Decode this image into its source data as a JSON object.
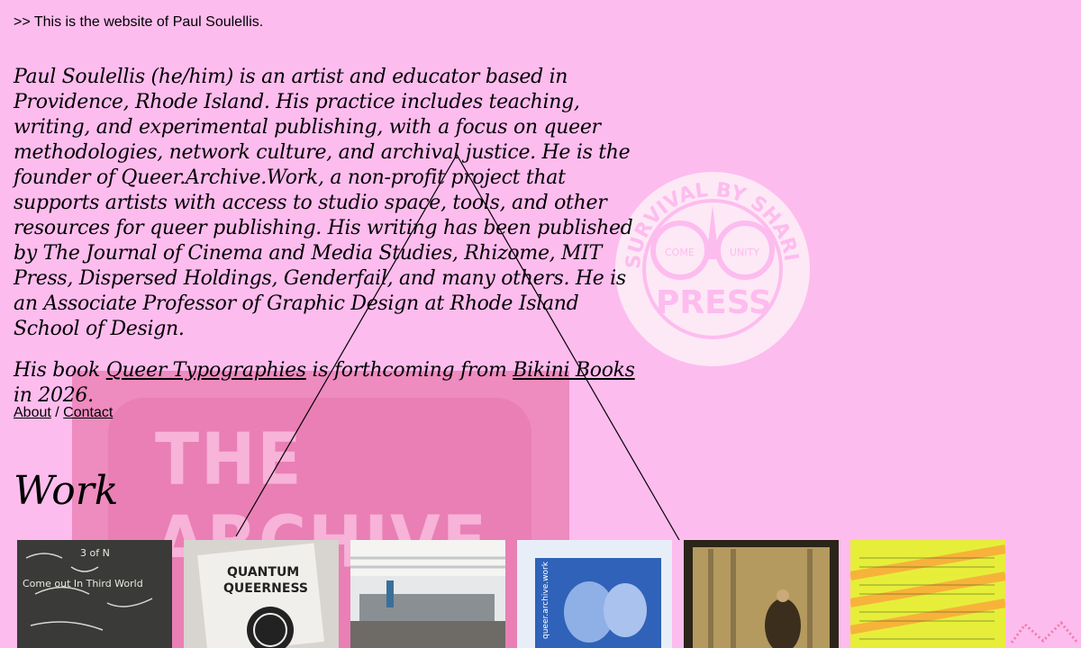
{
  "intro": ">> This is the website of Paul Soulellis.",
  "bio": {
    "line1": "Paul Soulellis (he/him) is an artist and educator based in Providence, Rhode Island. His practice includes teaching, writing, and experimental publishing, with a focus on queer methodologies, network culture, and archival justice. He is the founder of Queer.Archive.Work, a non-profit project that supports artists with access to studio space, tools, and other resources for queer publishing. His writing has been published by ",
    "journal": "The Journal of Cinema and Media Studies",
    "line1_tail": ", Rhizome, MIT Press, Dispersed Holdings, Genderfail, and many others. He is an Associate Professor of Graphic Design at Rhode Island School of Design.",
    "book_prefix": "His book ",
    "book_title": "Queer Typographies",
    "book_middle": " is forthcoming from ",
    "publisher": "Bikini Books",
    "book_suffix": " in 2026."
  },
  "nav": {
    "about": "About",
    "separator": "/",
    "contact": "Contact"
  },
  "work_heading": "Work",
  "decor": {
    "archive_text": "THE ARCHIVE",
    "seal_text": "SURVIVAL BY SHARING",
    "seal_center": "PRESS",
    "seal_left": "COME",
    "seal_right": "UNITY"
  },
  "thumbnails": [
    {
      "name": "thumb-chalkboard",
      "line1": "Come out In Third World",
      "line2": "3 of N"
    },
    {
      "name": "thumb-quantum-queerness",
      "line1": "QUANTUM",
      "line2": "QUEERNESS"
    },
    {
      "name": "thumb-studio",
      "line1": "",
      "line2": ""
    },
    {
      "name": "thumb-queer-archive-work",
      "line1": "queer.archive.work",
      "line2": ""
    },
    {
      "name": "thumb-sepia-photo",
      "line1": "",
      "line2": ""
    },
    {
      "name": "thumb-yellow-text",
      "line1": "",
      "line2": ""
    }
  ],
  "colors": {
    "background": "#fdbcee",
    "accent_pink": "#ee8bbf",
    "text": "#000000"
  }
}
